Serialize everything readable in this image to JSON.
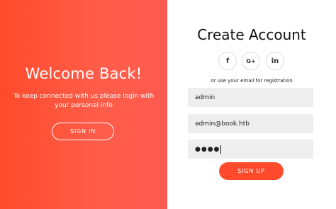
{
  "overlay": {
    "title": "Welcome Back!",
    "text": "To keep connected with us please login with your personal info",
    "signin_label": "SIGN IN"
  },
  "form": {
    "title": "Create Account",
    "social": [
      {
        "label": "f",
        "icon": "facebook-icon"
      },
      {
        "label": "G+",
        "icon": "google-plus-icon"
      },
      {
        "label": "in",
        "icon": "linkedin-icon"
      }
    ],
    "alt_text": "or use your email for registration",
    "name_value": "admin",
    "email_value": "admin@book.htb",
    "password_masked": "●●●●",
    "signup_label": "SIGN UP"
  },
  "colors": {
    "accent": "#ff4b2b",
    "gradient_end": "#ff5a4f",
    "field_bg": "#eeeeee"
  }
}
